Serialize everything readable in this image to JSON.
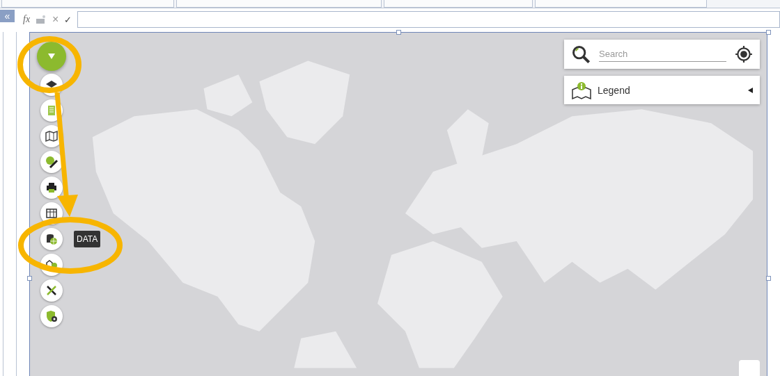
{
  "sidebar": {
    "collapse_glyph": "«"
  },
  "formula_bar": {
    "fx_label": "fx",
    "cancel_glyph": "×",
    "confirm_glyph": "✓"
  },
  "map": {
    "search": {
      "placeholder": "Search"
    },
    "legend": {
      "label": "Legend",
      "expanded": false
    },
    "menu_button": {
      "expanded": true
    },
    "tools": [
      {
        "kind": "layers"
      },
      {
        "kind": "report"
      },
      {
        "kind": "map"
      },
      {
        "kind": "edit-globe"
      },
      {
        "kind": "print"
      },
      {
        "kind": "table"
      },
      {
        "kind": "data",
        "tooltip": "DATA"
      },
      {
        "kind": "shapes"
      },
      {
        "kind": "tools"
      },
      {
        "kind": "security"
      }
    ]
  }
}
